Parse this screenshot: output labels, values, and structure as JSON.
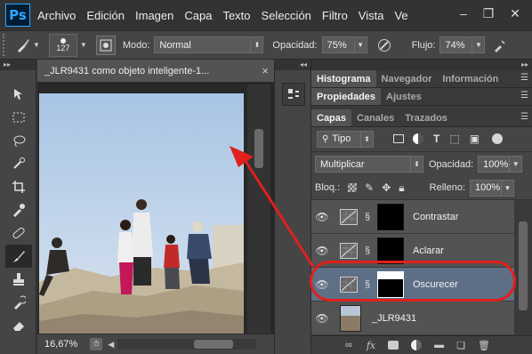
{
  "app": {
    "logo": "Ps"
  },
  "menu": [
    "Archivo",
    "Edición",
    "Imagen",
    "Capa",
    "Texto",
    "Selección",
    "Filtro",
    "Vista",
    "Ve"
  ],
  "window_buttons": {
    "minimize": "–",
    "maximize": "❐",
    "close": "✕"
  },
  "options": {
    "brush_size": "127",
    "mode_label": "Modo:",
    "mode_value": "Normal",
    "opacity_label": "Opacidad:",
    "opacity_value": "75%",
    "flow_label": "Flujo:",
    "flow_value": "74%"
  },
  "document": {
    "tab_title": "_JLR9431 como objeto inteligente-1...",
    "close_glyph": "×",
    "zoom": "16,67%"
  },
  "panels": {
    "row1_tabs": [
      "Histograma",
      "Navegador",
      "Información"
    ],
    "row2_tabs": [
      "Propiedades",
      "Ajustes"
    ],
    "row3_tabs": [
      "Capas",
      "Canales",
      "Trazados"
    ],
    "filter_kind": "Tipo",
    "blend_mode": "Multiplicar",
    "opacity_label": "Opacidad:",
    "opacity_value": "100%",
    "lock_label": "Bloq.:",
    "fill_label": "Relleno:",
    "fill_value": "100%"
  },
  "layers": [
    {
      "name": "Contrastar",
      "selected": false
    },
    {
      "name": "Aclarar",
      "selected": false
    },
    {
      "name": "Oscurecer",
      "selected": true
    },
    {
      "name": "_JLR9431",
      "selected": false
    }
  ],
  "colors": {
    "selected_layer": "#5e6f86",
    "annotation": "#e0201c",
    "accent": "#31a8ff"
  },
  "icons": {
    "tools": [
      "move-icon",
      "marquee-icon",
      "lasso-icon",
      "quick-select-icon",
      "crop-icon",
      "eyedropper-icon",
      "healing-icon",
      "brush-icon",
      "stamp-icon",
      "history-brush-icon",
      "eraser-icon"
    ]
  }
}
